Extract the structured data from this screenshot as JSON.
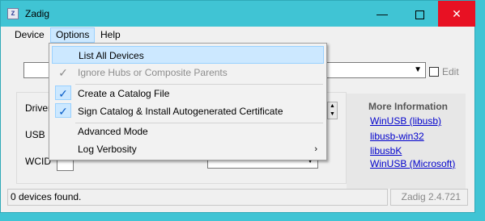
{
  "window": {
    "title": "Zadig",
    "icon": "zadig-app-icon"
  },
  "titlebar": {
    "minimize_glyph": "—",
    "close_glyph": "✕"
  },
  "menubar": {
    "device": "Device",
    "options": "Options",
    "help": "Help"
  },
  "device_row": {
    "edit_label": "Edit",
    "edit_checked": false
  },
  "driver_panel": {
    "driver_label": "Driver",
    "usb_id_label": "USB ID",
    "wcid_label": "WCID"
  },
  "info": {
    "title": "More Information",
    "links": [
      "WinUSB (libusb)",
      "libusb-win32",
      "libusbK",
      "WinUSB (Microsoft)"
    ]
  },
  "status": {
    "text": "0 devices found.",
    "version": "Zadig 2.4.721"
  },
  "options_menu": {
    "items": [
      {
        "label": "List All Devices",
        "checked": false,
        "enabled": true,
        "highlighted": true
      },
      {
        "label": "Ignore Hubs or Composite Parents",
        "checked": true,
        "enabled": false
      },
      {
        "label": "Create a Catalog File",
        "checked": true,
        "enabled": true
      },
      {
        "label": "Sign Catalog & Install Autogenerated Certificate",
        "checked": true,
        "enabled": true
      },
      {
        "label": "Advanced Mode",
        "checked": false,
        "enabled": true
      },
      {
        "label": "Log Verbosity",
        "checked": false,
        "enabled": true,
        "submenu": true
      }
    ],
    "check_glyph": "✓",
    "submenu_glyph": "›"
  },
  "colors": {
    "accent": "#40c4d4",
    "highlight": "#cce8ff",
    "close": "#e81123",
    "link": "#0000cc"
  }
}
